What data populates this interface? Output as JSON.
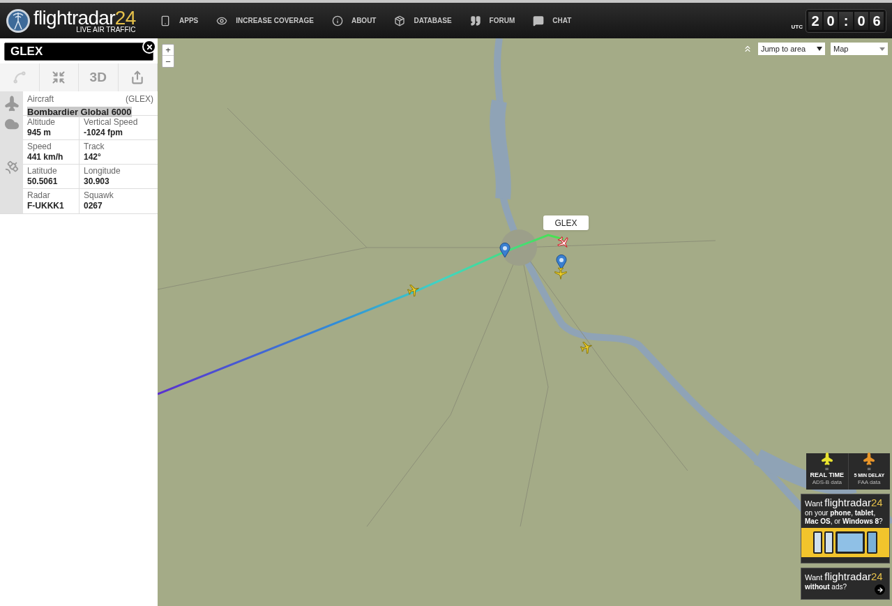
{
  "header": {
    "logo": {
      "name": "flightradar",
      "suffix": "24",
      "tagline": "LIVE AIR TRAFFIC"
    },
    "nav": [
      {
        "kind": "apps",
        "label": "APPS"
      },
      {
        "kind": "coverage",
        "label": "INCREASE COVERAGE"
      },
      {
        "kind": "about",
        "label": "ABOUT"
      },
      {
        "kind": "database",
        "label": "DATABASE"
      },
      {
        "kind": "forum",
        "label": "FORUM"
      },
      {
        "kind": "chat",
        "label": "CHAT"
      }
    ],
    "clock": {
      "zone": "UTC",
      "digits": [
        "2",
        "0",
        ":",
        "0",
        "6"
      ]
    }
  },
  "sidebar": {
    "title": "GLEX",
    "tools": [
      {
        "kind": "route",
        "disabled": true
      },
      {
        "kind": "collapse",
        "disabled": false
      },
      {
        "kind": "view",
        "label": "3D",
        "disabled": false
      },
      {
        "kind": "share",
        "disabled": false
      }
    ],
    "aircraft": {
      "label": "Aircraft",
      "code": "(GLEX)",
      "model": "Bombardier Global 6000"
    },
    "fields": [
      {
        "label": "Altitude",
        "value": "945 m"
      },
      {
        "label": "Vertical Speed",
        "value": "-1024 fpm"
      },
      {
        "label": "Speed",
        "value": "441 km/h"
      },
      {
        "label": "Track",
        "value": "142°"
      },
      {
        "label": "Latitude",
        "value": "50.5061"
      },
      {
        "label": "Longitude",
        "value": "30.903"
      },
      {
        "label": "Radar",
        "value": "F-UKKK1"
      },
      {
        "label": "Squawk",
        "value": "0267"
      }
    ]
  },
  "map": {
    "zoom": [
      "+",
      "−"
    ],
    "jump": "Jump to area",
    "layer": "Map",
    "flight_label": "GLEX",
    "aircraft": [
      {
        "selected": true
      },
      {
        "selected": false
      },
      {
        "selected": false
      },
      {
        "selected": false
      }
    ]
  },
  "legend": [
    {
      "kind": "realtime",
      "eq": "=",
      "title": "REAL TIME",
      "sub": "ADS-B data"
    },
    {
      "kind": "delayed",
      "eq": "=",
      "title": "5 MIN DELAY",
      "sub": "FAA data"
    }
  ],
  "ads": [
    {
      "lead": "Want",
      "brand": "flightradar",
      "suffix": "24",
      "text": "on your **phone**, **tablet**, **Mac OS**, or **Windows 8**?"
    },
    {
      "lead": "Want",
      "brand": "flightradar",
      "suffix": "24",
      "text": "**without** ads?"
    }
  ]
}
